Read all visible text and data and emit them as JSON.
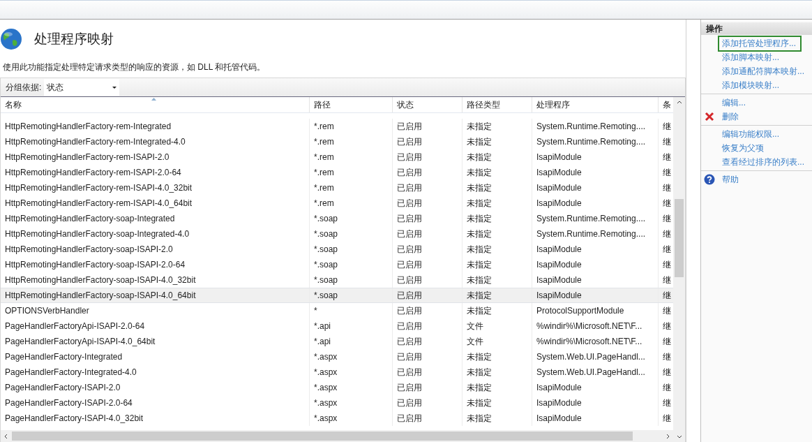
{
  "page": {
    "title": "处理程序映射",
    "description": "使用此功能指定处理特定请求类型的响应的资源，如 DLL 和托管代码。"
  },
  "group_by": {
    "label": "分组依据:",
    "value": "状态"
  },
  "table": {
    "columns": [
      "名称",
      "路径",
      "状态",
      "路径类型",
      "处理程序",
      "条"
    ],
    "rows": [
      {
        "name": "HttpRemotingHandlerFactory-rem-Integrated",
        "path": "*.rem",
        "status": "已启用",
        "path_type": "未指定",
        "handler": "System.Runtime.Remoting....",
        "entry": "继",
        "selected": false
      },
      {
        "name": "HttpRemotingHandlerFactory-rem-Integrated-4.0",
        "path": "*.rem",
        "status": "已启用",
        "path_type": "未指定",
        "handler": "System.Runtime.Remoting....",
        "entry": "继",
        "selected": false
      },
      {
        "name": "HttpRemotingHandlerFactory-rem-ISAPI-2.0",
        "path": "*.rem",
        "status": "已启用",
        "path_type": "未指定",
        "handler": "IsapiModule",
        "entry": "继",
        "selected": false
      },
      {
        "name": "HttpRemotingHandlerFactory-rem-ISAPI-2.0-64",
        "path": "*.rem",
        "status": "已启用",
        "path_type": "未指定",
        "handler": "IsapiModule",
        "entry": "继",
        "selected": false
      },
      {
        "name": "HttpRemotingHandlerFactory-rem-ISAPI-4.0_32bit",
        "path": "*.rem",
        "status": "已启用",
        "path_type": "未指定",
        "handler": "IsapiModule",
        "entry": "继",
        "selected": false
      },
      {
        "name": "HttpRemotingHandlerFactory-rem-ISAPI-4.0_64bit",
        "path": "*.rem",
        "status": "已启用",
        "path_type": "未指定",
        "handler": "IsapiModule",
        "entry": "继",
        "selected": false
      },
      {
        "name": "HttpRemotingHandlerFactory-soap-Integrated",
        "path": "*.soap",
        "status": "已启用",
        "path_type": "未指定",
        "handler": "System.Runtime.Remoting....",
        "entry": "继",
        "selected": false
      },
      {
        "name": "HttpRemotingHandlerFactory-soap-Integrated-4.0",
        "path": "*.soap",
        "status": "已启用",
        "path_type": "未指定",
        "handler": "System.Runtime.Remoting....",
        "entry": "继",
        "selected": false
      },
      {
        "name": "HttpRemotingHandlerFactory-soap-ISAPI-2.0",
        "path": "*.soap",
        "status": "已启用",
        "path_type": "未指定",
        "handler": "IsapiModule",
        "entry": "继",
        "selected": false
      },
      {
        "name": "HttpRemotingHandlerFactory-soap-ISAPI-2.0-64",
        "path": "*.soap",
        "status": "已启用",
        "path_type": "未指定",
        "handler": "IsapiModule",
        "entry": "继",
        "selected": false
      },
      {
        "name": "HttpRemotingHandlerFactory-soap-ISAPI-4.0_32bit",
        "path": "*.soap",
        "status": "已启用",
        "path_type": "未指定",
        "handler": "IsapiModule",
        "entry": "继",
        "selected": false
      },
      {
        "name": "HttpRemotingHandlerFactory-soap-ISAPI-4.0_64bit",
        "path": "*.soap",
        "status": "已启用",
        "path_type": "未指定",
        "handler": "IsapiModule",
        "entry": "继",
        "selected": true
      },
      {
        "name": "OPTIONSVerbHandler",
        "path": "*",
        "status": "已启用",
        "path_type": "未指定",
        "handler": "ProtocolSupportModule",
        "entry": "继",
        "selected": false
      },
      {
        "name": "PageHandlerFactoryApi-ISAPI-2.0-64",
        "path": "*.api",
        "status": "已启用",
        "path_type": "文件",
        "handler": "%windir%\\Microsoft.NET\\F...",
        "entry": "继",
        "selected": false
      },
      {
        "name": "PageHandlerFactoryApi-ISAPI-4.0_64bit",
        "path": "*.api",
        "status": "已启用",
        "path_type": "文件",
        "handler": "%windir%\\Microsoft.NET\\F...",
        "entry": "继",
        "selected": false
      },
      {
        "name": "PageHandlerFactory-Integrated",
        "path": "*.aspx",
        "status": "已启用",
        "path_type": "未指定",
        "handler": "System.Web.UI.PageHandl...",
        "entry": "继",
        "selected": false
      },
      {
        "name": "PageHandlerFactory-Integrated-4.0",
        "path": "*.aspx",
        "status": "已启用",
        "path_type": "未指定",
        "handler": "System.Web.UI.PageHandl...",
        "entry": "继",
        "selected": false
      },
      {
        "name": "PageHandlerFactory-ISAPI-2.0",
        "path": "*.aspx",
        "status": "已启用",
        "path_type": "未指定",
        "handler": "IsapiModule",
        "entry": "继",
        "selected": false
      },
      {
        "name": "PageHandlerFactory-ISAPI-2.0-64",
        "path": "*.aspx",
        "status": "已启用",
        "path_type": "未指定",
        "handler": "IsapiModule",
        "entry": "继",
        "selected": false
      },
      {
        "name": "PageHandlerFactory-ISAPI-4.0_32bit",
        "path": "*.aspx",
        "status": "已启用",
        "path_type": "未指定",
        "handler": "IsapiModule",
        "entry": "继",
        "selected": false
      }
    ]
  },
  "actions": {
    "title": "操作",
    "groups": [
      [
        {
          "label": "添加托管处理程序...",
          "kind": "link",
          "focused": true
        },
        {
          "label": "添加脚本映射...",
          "kind": "link",
          "focused": false
        },
        {
          "label": "添加通配符脚本映射...",
          "kind": "link",
          "focused": false
        },
        {
          "label": "添加模块映射...",
          "kind": "link",
          "focused": false
        }
      ],
      [
        {
          "label": "编辑...",
          "kind": "link",
          "focused": false
        },
        {
          "label": "删除",
          "kind": "delete",
          "focused": false
        }
      ],
      [
        {
          "label": "编辑功能权限...",
          "kind": "link",
          "focused": false
        },
        {
          "label": "恢复为父项",
          "kind": "link",
          "focused": false
        },
        {
          "label": "查看经过排序的列表...",
          "kind": "link",
          "focused": false
        }
      ],
      [
        {
          "label": "帮助",
          "kind": "help",
          "focused": false
        }
      ]
    ]
  }
}
